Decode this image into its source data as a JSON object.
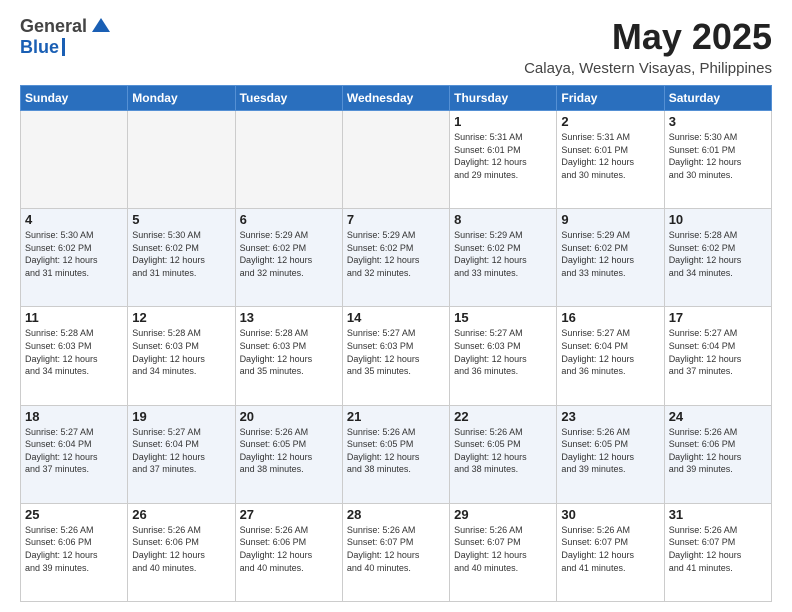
{
  "header": {
    "logo_general": "General",
    "logo_blue": "Blue",
    "title": "May 2025",
    "subtitle": "Calaya, Western Visayas, Philippines"
  },
  "weekdays": [
    "Sunday",
    "Monday",
    "Tuesday",
    "Wednesday",
    "Thursday",
    "Friday",
    "Saturday"
  ],
  "weeks": [
    [
      {
        "day": "",
        "info": ""
      },
      {
        "day": "",
        "info": ""
      },
      {
        "day": "",
        "info": ""
      },
      {
        "day": "",
        "info": ""
      },
      {
        "day": "1",
        "info": "Sunrise: 5:31 AM\nSunset: 6:01 PM\nDaylight: 12 hours\nand 29 minutes."
      },
      {
        "day": "2",
        "info": "Sunrise: 5:31 AM\nSunset: 6:01 PM\nDaylight: 12 hours\nand 30 minutes."
      },
      {
        "day": "3",
        "info": "Sunrise: 5:30 AM\nSunset: 6:01 PM\nDaylight: 12 hours\nand 30 minutes."
      }
    ],
    [
      {
        "day": "4",
        "info": "Sunrise: 5:30 AM\nSunset: 6:02 PM\nDaylight: 12 hours\nand 31 minutes."
      },
      {
        "day": "5",
        "info": "Sunrise: 5:30 AM\nSunset: 6:02 PM\nDaylight: 12 hours\nand 31 minutes."
      },
      {
        "day": "6",
        "info": "Sunrise: 5:29 AM\nSunset: 6:02 PM\nDaylight: 12 hours\nand 32 minutes."
      },
      {
        "day": "7",
        "info": "Sunrise: 5:29 AM\nSunset: 6:02 PM\nDaylight: 12 hours\nand 32 minutes."
      },
      {
        "day": "8",
        "info": "Sunrise: 5:29 AM\nSunset: 6:02 PM\nDaylight: 12 hours\nand 33 minutes."
      },
      {
        "day": "9",
        "info": "Sunrise: 5:29 AM\nSunset: 6:02 PM\nDaylight: 12 hours\nand 33 minutes."
      },
      {
        "day": "10",
        "info": "Sunrise: 5:28 AM\nSunset: 6:02 PM\nDaylight: 12 hours\nand 34 minutes."
      }
    ],
    [
      {
        "day": "11",
        "info": "Sunrise: 5:28 AM\nSunset: 6:03 PM\nDaylight: 12 hours\nand 34 minutes."
      },
      {
        "day": "12",
        "info": "Sunrise: 5:28 AM\nSunset: 6:03 PM\nDaylight: 12 hours\nand 34 minutes."
      },
      {
        "day": "13",
        "info": "Sunrise: 5:28 AM\nSunset: 6:03 PM\nDaylight: 12 hours\nand 35 minutes."
      },
      {
        "day": "14",
        "info": "Sunrise: 5:27 AM\nSunset: 6:03 PM\nDaylight: 12 hours\nand 35 minutes."
      },
      {
        "day": "15",
        "info": "Sunrise: 5:27 AM\nSunset: 6:03 PM\nDaylight: 12 hours\nand 36 minutes."
      },
      {
        "day": "16",
        "info": "Sunrise: 5:27 AM\nSunset: 6:04 PM\nDaylight: 12 hours\nand 36 minutes."
      },
      {
        "day": "17",
        "info": "Sunrise: 5:27 AM\nSunset: 6:04 PM\nDaylight: 12 hours\nand 37 minutes."
      }
    ],
    [
      {
        "day": "18",
        "info": "Sunrise: 5:27 AM\nSunset: 6:04 PM\nDaylight: 12 hours\nand 37 minutes."
      },
      {
        "day": "19",
        "info": "Sunrise: 5:27 AM\nSunset: 6:04 PM\nDaylight: 12 hours\nand 37 minutes."
      },
      {
        "day": "20",
        "info": "Sunrise: 5:26 AM\nSunset: 6:05 PM\nDaylight: 12 hours\nand 38 minutes."
      },
      {
        "day": "21",
        "info": "Sunrise: 5:26 AM\nSunset: 6:05 PM\nDaylight: 12 hours\nand 38 minutes."
      },
      {
        "day": "22",
        "info": "Sunrise: 5:26 AM\nSunset: 6:05 PM\nDaylight: 12 hours\nand 38 minutes."
      },
      {
        "day": "23",
        "info": "Sunrise: 5:26 AM\nSunset: 6:05 PM\nDaylight: 12 hours\nand 39 minutes."
      },
      {
        "day": "24",
        "info": "Sunrise: 5:26 AM\nSunset: 6:06 PM\nDaylight: 12 hours\nand 39 minutes."
      }
    ],
    [
      {
        "day": "25",
        "info": "Sunrise: 5:26 AM\nSunset: 6:06 PM\nDaylight: 12 hours\nand 39 minutes."
      },
      {
        "day": "26",
        "info": "Sunrise: 5:26 AM\nSunset: 6:06 PM\nDaylight: 12 hours\nand 40 minutes."
      },
      {
        "day": "27",
        "info": "Sunrise: 5:26 AM\nSunset: 6:06 PM\nDaylight: 12 hours\nand 40 minutes."
      },
      {
        "day": "28",
        "info": "Sunrise: 5:26 AM\nSunset: 6:07 PM\nDaylight: 12 hours\nand 40 minutes."
      },
      {
        "day": "29",
        "info": "Sunrise: 5:26 AM\nSunset: 6:07 PM\nDaylight: 12 hours\nand 40 minutes."
      },
      {
        "day": "30",
        "info": "Sunrise: 5:26 AM\nSunset: 6:07 PM\nDaylight: 12 hours\nand 41 minutes."
      },
      {
        "day": "31",
        "info": "Sunrise: 5:26 AM\nSunset: 6:07 PM\nDaylight: 12 hours\nand 41 minutes."
      }
    ]
  ]
}
